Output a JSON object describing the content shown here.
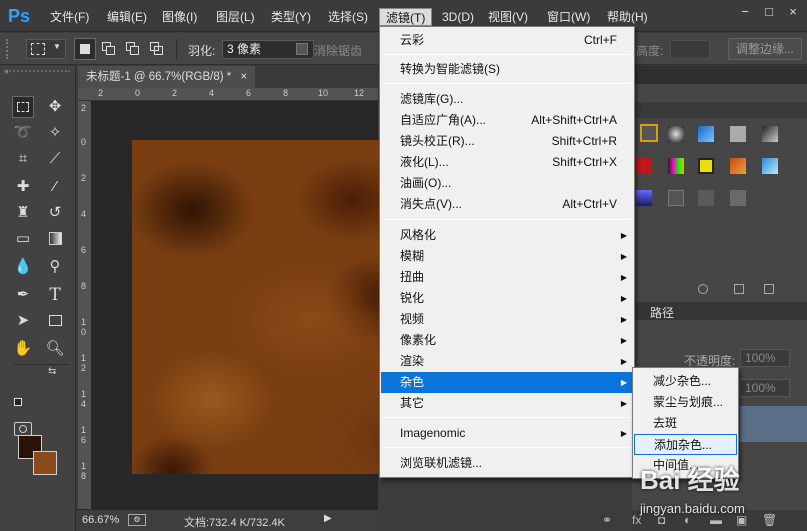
{
  "app": {
    "logo": "Ps"
  },
  "menubar": {
    "items": [
      "文件(F)",
      "编辑(E)",
      "图像(I)",
      "图层(L)",
      "类型(Y)",
      "选择(S)",
      "滤镜(T)",
      "3D(D)",
      "视图(V)",
      "窗口(W)",
      "帮助(H)"
    ],
    "window_controls": [
      "−",
      "□",
      "×"
    ]
  },
  "options": {
    "feather_label": "羽化:",
    "feather_value": "3 像素",
    "antialias_label": "消除锯齿",
    "height_label": "高度:",
    "refine_edge": "调整边缘..."
  },
  "document": {
    "tab_label": "未标题-1 @ 66.7%(RGB/8) *",
    "close": "×"
  },
  "ruler": {
    "top": [
      "2",
      "0",
      "2",
      "4",
      "6",
      "8",
      "10",
      "12",
      "14"
    ],
    "left": [
      "2",
      "0",
      "2",
      "4",
      "6",
      "8",
      "1 0",
      "1 2",
      "1 4",
      "1 6",
      "1 8",
      "2"
    ]
  },
  "status": {
    "zoom": "66.67%",
    "doc_info": "文档:732.4 K/732.4K"
  },
  "filter_menu": {
    "items": [
      {
        "label": "云彩",
        "shortcut": "Ctrl+F"
      },
      {
        "label": "转换为智能滤镜(S)",
        "shortcut": ""
      },
      {
        "label": "滤镜库(G)...",
        "shortcut": ""
      },
      {
        "label": "自适应广角(A)...",
        "shortcut": "Alt+Shift+Ctrl+A"
      },
      {
        "label": "镜头校正(R)...",
        "shortcut": "Shift+Ctrl+R"
      },
      {
        "label": "液化(L)...",
        "shortcut": "Shift+Ctrl+X"
      },
      {
        "label": "油画(O)...",
        "shortcut": ""
      },
      {
        "label": "消失点(V)...",
        "shortcut": "Alt+Ctrl+V"
      },
      {
        "label": "风格化",
        "shortcut": ""
      },
      {
        "label": "模糊",
        "shortcut": ""
      },
      {
        "label": "扭曲",
        "shortcut": ""
      },
      {
        "label": "锐化",
        "shortcut": ""
      },
      {
        "label": "视频",
        "shortcut": ""
      },
      {
        "label": "像素化",
        "shortcut": ""
      },
      {
        "label": "渲染",
        "shortcut": ""
      },
      {
        "label": "杂色",
        "shortcut": ""
      },
      {
        "label": "其它",
        "shortcut": ""
      },
      {
        "label": "Imagenomic",
        "shortcut": ""
      },
      {
        "label": "浏览联机滤镜...",
        "shortcut": ""
      }
    ],
    "submenu_arrow": "▶"
  },
  "noise_submenu": {
    "items": [
      "减少杂色...",
      "蒙尘与划痕...",
      "去斑",
      "添加杂色...",
      "中间值..."
    ]
  },
  "right_panel": {
    "tab_paths": "路径",
    "opacity_label": "不透明度:",
    "opacity_value": "100%",
    "fill_value": "100%"
  },
  "watermark": {
    "text": "Bai 经验",
    "url": "jingyan.baidu.com"
  },
  "colors": {
    "accent": "#0a74da",
    "foreground": "#2a1206",
    "background": "#8a4b1c"
  }
}
